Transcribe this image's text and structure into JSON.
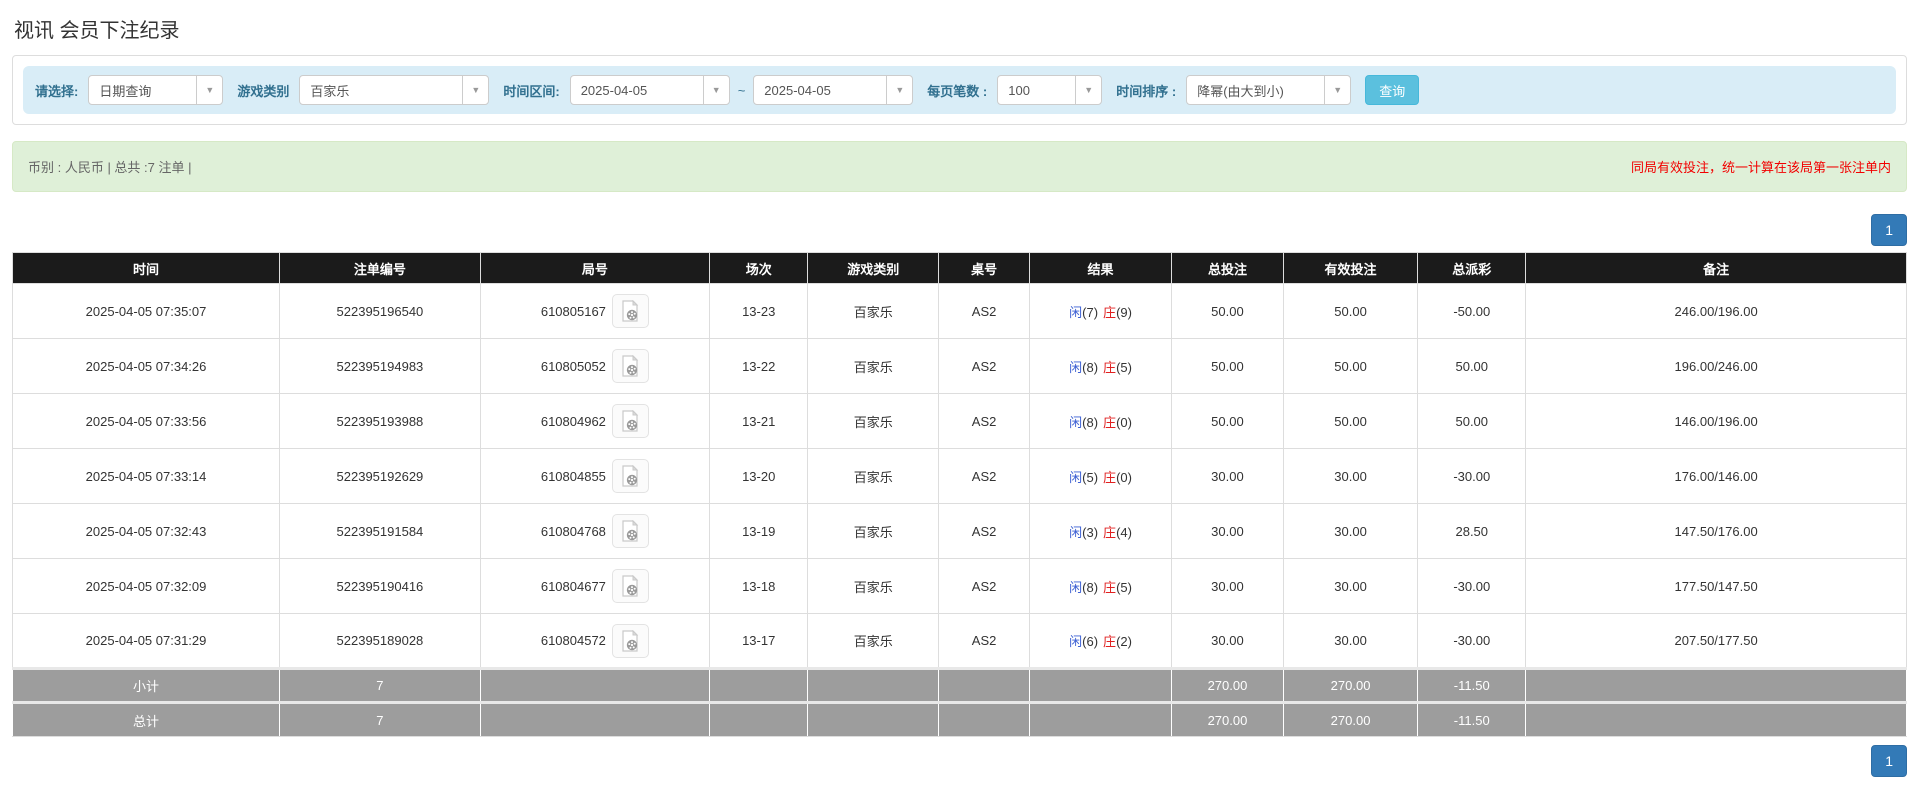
{
  "page": {
    "title": "视讯 会员下注纪录"
  },
  "filters": {
    "select_label": "请选择:",
    "select_value": "日期查询",
    "game_type_label": "游戏类别",
    "game_type_value": "百家乐",
    "time_range_label": "时间区间:",
    "date_from": "2025-04-05",
    "tilde": "~",
    "date_to": "2025-04-05",
    "page_size_label": "每页笔数 :",
    "page_size_value": "100",
    "sort_label": "时间排序 :",
    "sort_value": "降幂(由大到小)",
    "search_button": "查询",
    "caret_icon": "▼"
  },
  "summary": {
    "left": "币别 : 人民币 | 总共 :7 注单 |",
    "right": "同局有效投注，统一计算在该局第一张注单内"
  },
  "pagination": {
    "page": "1"
  },
  "table": {
    "headers": [
      "时间",
      "注单编号",
      "局号",
      "场次",
      "游戏类别",
      "桌号",
      "结果",
      "总投注",
      "有效投注",
      "总派彩",
      "备注"
    ],
    "rows": [
      {
        "time": "2025-04-05 07:35:07",
        "bet_id": "522395196540",
        "round_id": "610805167",
        "session": "13-23",
        "game": "百家乐",
        "table_no": "AS2",
        "player": "闲",
        "player_pts": "(7)",
        "banker": "庄",
        "banker_pts": "(9)",
        "total_bet": "50.00",
        "valid_bet": "50.00",
        "payout": "-50.00",
        "remark": "246.00/196.00"
      },
      {
        "time": "2025-04-05 07:34:26",
        "bet_id": "522395194983",
        "round_id": "610805052",
        "session": "13-22",
        "game": "百家乐",
        "table_no": "AS2",
        "player": "闲",
        "player_pts": "(8)",
        "banker": "庄",
        "banker_pts": "(5)",
        "total_bet": "50.00",
        "valid_bet": "50.00",
        "payout": "50.00",
        "remark": "196.00/246.00"
      },
      {
        "time": "2025-04-05 07:33:56",
        "bet_id": "522395193988",
        "round_id": "610804962",
        "session": "13-21",
        "game": "百家乐",
        "table_no": "AS2",
        "player": "闲",
        "player_pts": "(8)",
        "banker": "庄",
        "banker_pts": "(0)",
        "total_bet": "50.00",
        "valid_bet": "50.00",
        "payout": "50.00",
        "remark": "146.00/196.00"
      },
      {
        "time": "2025-04-05 07:33:14",
        "bet_id": "522395192629",
        "round_id": "610804855",
        "session": "13-20",
        "game": "百家乐",
        "table_no": "AS2",
        "player": "闲",
        "player_pts": "(5)",
        "banker": "庄",
        "banker_pts": "(0)",
        "total_bet": "30.00",
        "valid_bet": "30.00",
        "payout": "-30.00",
        "remark": "176.00/146.00"
      },
      {
        "time": "2025-04-05 07:32:43",
        "bet_id": "522395191584",
        "round_id": "610804768",
        "session": "13-19",
        "game": "百家乐",
        "table_no": "AS2",
        "player": "闲",
        "player_pts": "(3)",
        "banker": "庄",
        "banker_pts": "(4)",
        "total_bet": "30.00",
        "valid_bet": "30.00",
        "payout": "28.50",
        "remark": "147.50/176.00"
      },
      {
        "time": "2025-04-05 07:32:09",
        "bet_id": "522395190416",
        "round_id": "610804677",
        "session": "13-18",
        "game": "百家乐",
        "table_no": "AS2",
        "player": "闲",
        "player_pts": "(8)",
        "banker": "庄",
        "banker_pts": "(5)",
        "total_bet": "30.00",
        "valid_bet": "30.00",
        "payout": "-30.00",
        "remark": "177.50/147.50"
      },
      {
        "time": "2025-04-05 07:31:29",
        "bet_id": "522395189028",
        "round_id": "610804572",
        "session": "13-17",
        "game": "百家乐",
        "table_no": "AS2",
        "player": "闲",
        "player_pts": "(6)",
        "banker": "庄",
        "banker_pts": "(2)",
        "total_bet": "30.00",
        "valid_bet": "30.00",
        "payout": "-30.00",
        "remark": "207.50/177.50"
      }
    ],
    "subtotal": {
      "label": "小计",
      "count": "7",
      "total_bet": "270.00",
      "valid_bet": "270.00",
      "payout": "-11.50"
    },
    "total": {
      "label": "总计",
      "count": "7",
      "total_bet": "270.00",
      "valid_bet": "270.00",
      "payout": "-11.50"
    }
  },
  "colors": {
    "filter_bar_bg": "#d9edf7",
    "filter_label": "#31708f",
    "query_button_bg": "#5bc0de",
    "notice_bg": "#dff0d8",
    "notice_text": "#666666",
    "notice_warning_text": "#f20000",
    "table_header_bg": "#1b1b1b",
    "table_footer_bg": "#9d9d9d",
    "link_blue": "#2e7bcc",
    "player_blue": "#3b5fd3",
    "banker_red": "#e02020",
    "negative_red": "#f00000",
    "pagination_bg": "#337ab7"
  }
}
